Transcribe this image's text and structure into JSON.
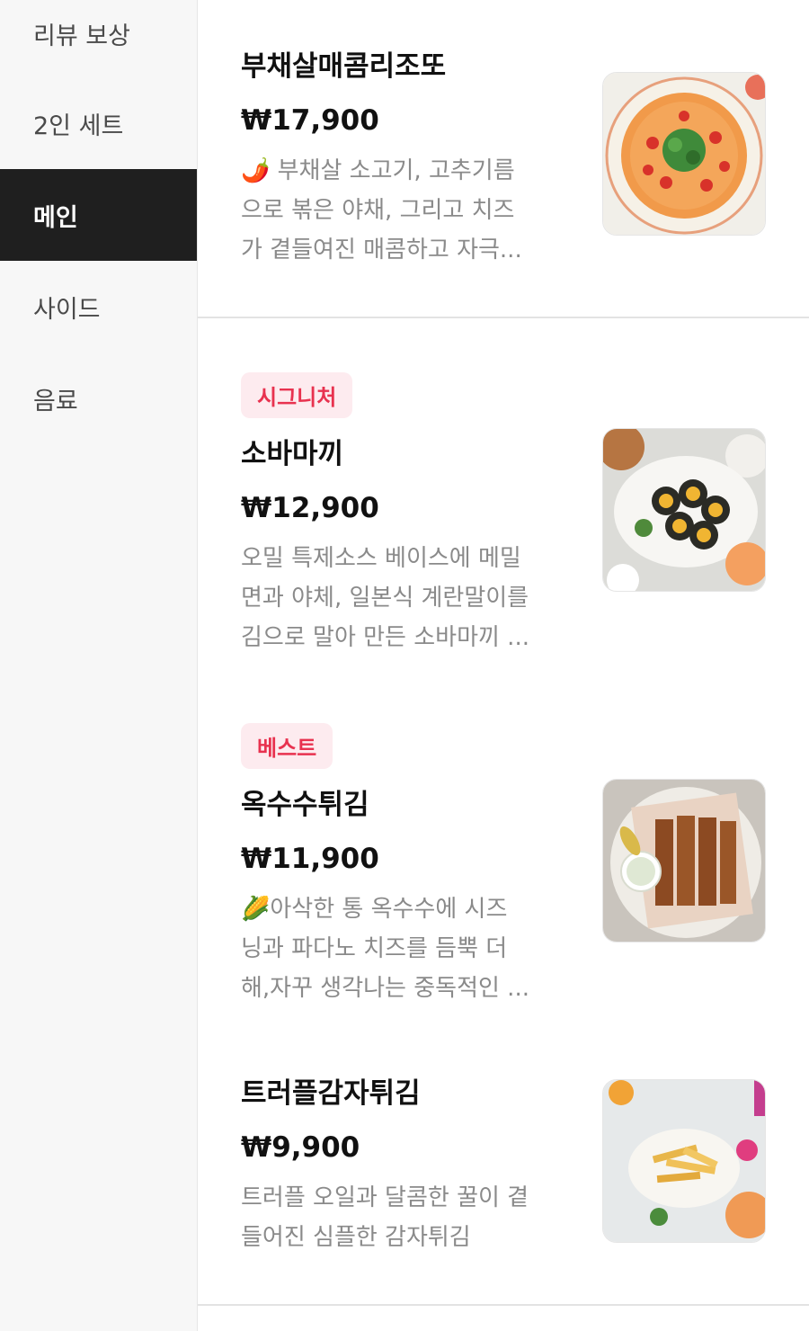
{
  "sidebar": {
    "items": [
      {
        "label": "리뷰 보상"
      },
      {
        "label": "2인 세트"
      },
      {
        "label": "메인"
      },
      {
        "label": "사이드"
      },
      {
        "label": "음료"
      }
    ]
  },
  "menu": {
    "items": [
      {
        "name": "부채살매콤리조또",
        "price": "₩17,900",
        "desc_lines": [
          "🌶️ 부채살 소고기, 고추기름",
          "으로 볶은 야채, 그리고 치즈",
          "가 곁들여진 매콤하고 자극..."
        ],
        "image_icon": "risotto-photo"
      },
      {
        "badge": "시그니처",
        "name": "소바마끼",
        "price": "₩12,900",
        "desc_lines": [
          "오밀 특제소스 베이스에 메밀",
          "면과 야체, 일본식 계란말이를",
          "김으로 말아 만든 소바마끼 ..."
        ],
        "image_icon": "soba-maki-photo"
      },
      {
        "badge": "베스트",
        "name": "옥수수튀김",
        "price": "₩11,900",
        "desc_lines": [
          "🌽아삭한 통 옥수수에 시즈",
          "닝과 파다노 치즈를 듬뿍 더",
          "해,자꾸 생각나는 중독적인 ..."
        ],
        "image_icon": "corn-fries-photo"
      },
      {
        "name": "트러플감자튀김",
        "price": "₩9,900",
        "desc_lines": [
          "트러플 오일과 달콤한 꿀이 곁",
          "들어진 심플한 감자튀김"
        ],
        "image_icon": "truffle-fries-photo"
      }
    ]
  },
  "colors": {
    "sidebar_active_bg": "#1f1f1f",
    "badge_text": "#e8324f",
    "badge_bg": "#fdebef",
    "desc_text": "#8a8a8a"
  }
}
